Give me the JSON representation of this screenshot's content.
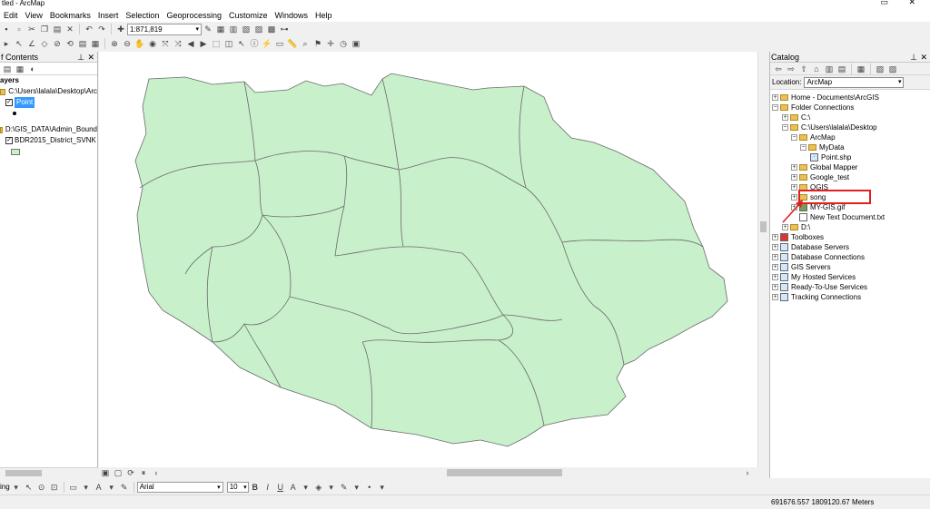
{
  "app": {
    "title": "tled - ArcMap",
    "window_buttons": "▭ ✕"
  },
  "menu": [
    "Edit",
    "View",
    "Bookmarks",
    "Insert",
    "Selection",
    "Geoprocessing",
    "Customize",
    "Windows",
    "Help"
  ],
  "toolbar": {
    "scale": "1:871,819"
  },
  "toc": {
    "title": "f Contents",
    "layers_label": "ayers",
    "group1_path": "C:\\Users\\lalala\\Desktop\\Arc",
    "point_layer": "Point",
    "group2_path": "D:\\GIS_DATA\\Admin_Bound",
    "district_layer": "BDR2015_District_SVNK"
  },
  "catalog": {
    "title": "Catalog",
    "location_label": "Location:",
    "location_value": "ArcMap",
    "tree": {
      "home": "Home - Documents\\ArcGIS",
      "folder_connections": "Folder Connections",
      "c_drive": "C:\\",
      "desktop": "C:\\Users\\lalala\\Desktop",
      "arcmap": "ArcMap",
      "mydata": "MyData",
      "point_shp": "Point.shp",
      "global_mapper": "Global Mapper",
      "google_test": "Google_test",
      "qgis": "QGIS",
      "song": "song",
      "gif": "MY-GIS.gif",
      "txt": "New Text Document.txt",
      "d_drive": "D:\\",
      "toolboxes": "Toolboxes",
      "db_servers": "Database Servers",
      "db_connections": "Database Connections",
      "gis_servers": "GIS Servers",
      "hosted": "My Hosted Services",
      "ready": "Ready-To-Use Services",
      "tracking": "Tracking Connections"
    }
  },
  "drawing": {
    "drawing_label": "ing",
    "font_name": "Arial",
    "font_size": "10"
  },
  "status": {
    "coordinates": "691676.557  1809120.67 Meters"
  },
  "colors": {
    "polygon_fill": "#c8f0cb",
    "polygon_stroke": "#6a6a6a",
    "highlight": "#e02020",
    "selection": "#3399ff"
  }
}
